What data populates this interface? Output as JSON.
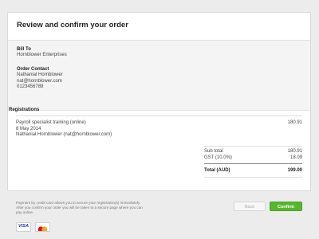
{
  "header": {
    "title": "Review and confirm your order"
  },
  "bill_to": {
    "label": "Bill To",
    "name": "Hornblower Enterprises"
  },
  "order_contact": {
    "label": "Order Contact",
    "name": "Nathanial Hornblower",
    "email": "nat@hornblower.com",
    "phone": "0123456789"
  },
  "registrations": {
    "title": "Registrations",
    "items": [
      {
        "course": "Payroll specialist training (online)",
        "date": "8 May 2014",
        "attendee": "Nathanial Hornblower (nat@hornblower.com)",
        "price": "180.91"
      }
    ]
  },
  "summary": {
    "subtotal_label": "Sub total",
    "subtotal_value": "180.91",
    "gst_label": "GST (10.0%)",
    "gst_value": "18.09",
    "total_label": "Total (AUD)",
    "total_value": "199.00"
  },
  "footer": {
    "note_line1": "Payment by credit card allows you to secure your registration(s) immediately.",
    "note_line2": "After you confirm your order you will be taken to a secure page where you can",
    "note_line3": "pay online.",
    "back_label": "Back",
    "confirm_label": "Confirm"
  },
  "payment_logos": {
    "visa": "VISA",
    "mastercard_icon": "mastercard-icon"
  },
  "colors": {
    "confirm_green": "#58b62c",
    "visa_blue": "#1a3d8f",
    "mc_red": "#eb001b",
    "mc_orange": "#f79e1b"
  }
}
